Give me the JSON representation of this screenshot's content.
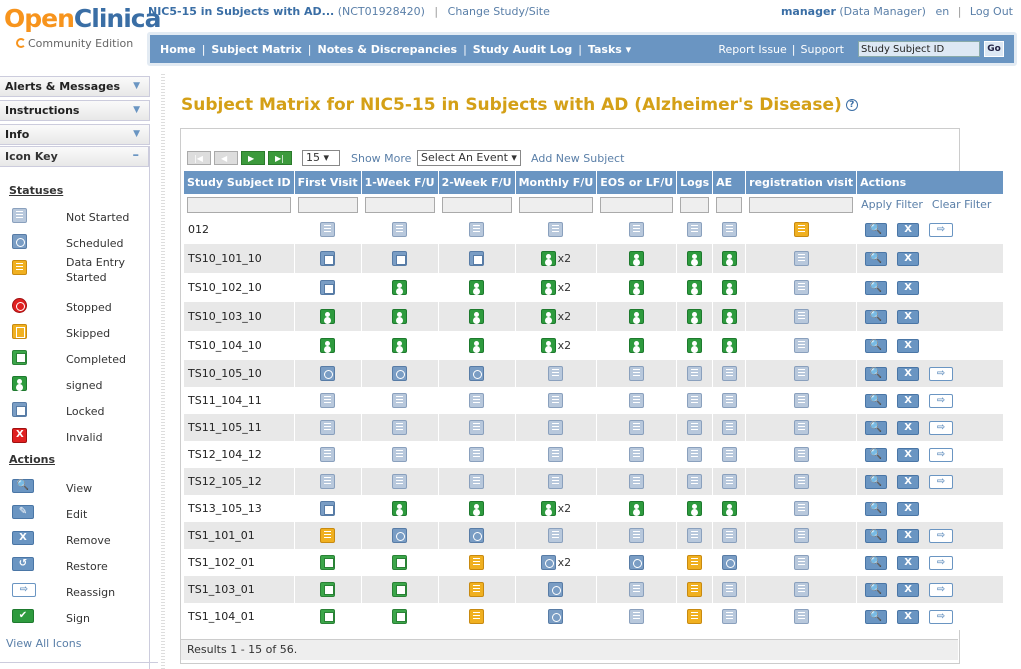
{
  "app": {
    "logo_open": "Open",
    "logo_clinica": "Clinica",
    "logo_edition": "Community Edition"
  },
  "header": {
    "study_name": "NIC5-15 in Subjects with AD...",
    "protocol_id": "(NCT01928420)",
    "separator": "|",
    "change_study": "Change Study/Site",
    "username": "manager",
    "role": "(Data Manager)",
    "language": "en",
    "logout": "Log Out"
  },
  "nav": {
    "items": [
      "Home",
      "Subject Matrix",
      "Notes & Discrepancies",
      "Study Audit Log",
      "Tasks ▾"
    ],
    "report_issue": "Report Issue",
    "support": "Support",
    "search_value": "Study Subject ID",
    "go_label": "Go"
  },
  "sidebar": {
    "panels": [
      "Alerts & Messages",
      "Instructions",
      "Info"
    ],
    "icon_key_title": "Icon Key",
    "statuses_title": "Statuses",
    "statuses": [
      {
        "icon": "not-started-icon",
        "label": "Not Started"
      },
      {
        "icon": "scheduled-icon",
        "label": "Scheduled"
      },
      {
        "icon": "data-entry-started-icon",
        "label": "Data Entry Started"
      },
      {
        "icon": "stopped-icon",
        "label": "Stopped"
      },
      {
        "icon": "skipped-icon",
        "label": "Skipped"
      },
      {
        "icon": "completed-icon",
        "label": "Completed"
      },
      {
        "icon": "signed-icon",
        "label": "signed"
      },
      {
        "icon": "locked-icon",
        "label": "Locked"
      },
      {
        "icon": "invalid-icon",
        "label": "Invalid"
      }
    ],
    "actions_title": "Actions",
    "actions": [
      {
        "icon": "view-icon",
        "label": "View"
      },
      {
        "icon": "edit-icon",
        "label": "Edit"
      },
      {
        "icon": "remove-icon",
        "label": "Remove"
      },
      {
        "icon": "restore-icon",
        "label": "Restore"
      },
      {
        "icon": "reassign-icon",
        "label": "Reassign"
      },
      {
        "icon": "sign-icon",
        "label": "Sign"
      }
    ],
    "view_all_icons": "View All Icons"
  },
  "main": {
    "title": "Subject Matrix for NIC5-15 in Subjects with AD (Alzheimer's Disease)",
    "page_size": "15 ▾",
    "show_more": "Show More",
    "select_event": "Select An Event ▾",
    "add_new_subject": "Add New Subject",
    "apply_filter": "Apply Filter",
    "clear_filter": "Clear Filter",
    "columns": [
      "Study Subject ID",
      "First Visit",
      "1-Week F/U",
      "2-Week F/U",
      "Monthly F/U",
      "EOS or LF/U",
      "Logs",
      "AE",
      "registration visit",
      "Actions"
    ],
    "results": "Results 1 - 15 of 56."
  },
  "colors": {
    "accent": "#6a95c2",
    "title": "#d4a017",
    "completed": "#3ca64a",
    "signed": "#2e9b3e",
    "data_entry_started": "#f0b020",
    "stopped": "#e02020"
  },
  "rows": [
    {
      "id": "012",
      "ev": [
        "ns",
        "ns",
        "ns",
        "ns",
        "ns",
        "ns",
        "ns",
        "des"
      ],
      "mult": [
        "",
        "",
        "",
        "",
        "",
        "",
        "",
        ""
      ],
      "acts": [
        "view",
        "remove",
        "reassign"
      ]
    },
    {
      "id": "TS10_101_10",
      "ev": [
        "lock",
        "lock",
        "lock",
        "sig",
        "sig",
        "sig",
        "sig",
        "ns"
      ],
      "mult": [
        "",
        "",
        "",
        "x2",
        "",
        "",
        "",
        ""
      ],
      "acts": [
        "view",
        "remove"
      ]
    },
    {
      "id": "TS10_102_10",
      "ev": [
        "lock",
        "sig",
        "sig",
        "sig",
        "sig",
        "sig",
        "sig",
        "ns"
      ],
      "mult": [
        "",
        "",
        "",
        "x2",
        "",
        "",
        "",
        ""
      ],
      "acts": [
        "view",
        "remove"
      ]
    },
    {
      "id": "TS10_103_10",
      "ev": [
        "sig",
        "sig",
        "sig",
        "sig",
        "sig",
        "sig",
        "sig",
        "ns"
      ],
      "mult": [
        "",
        "",
        "",
        "x2",
        "",
        "",
        "",
        ""
      ],
      "acts": [
        "view",
        "remove"
      ]
    },
    {
      "id": "TS10_104_10",
      "ev": [
        "sig",
        "sig",
        "sig",
        "sig",
        "sig",
        "sig",
        "sig",
        "ns"
      ],
      "mult": [
        "",
        "",
        "",
        "x2",
        "",
        "",
        "",
        ""
      ],
      "acts": [
        "view",
        "remove"
      ]
    },
    {
      "id": "TS10_105_10",
      "ev": [
        "sch",
        "sch",
        "sch",
        "ns",
        "ns",
        "ns",
        "ns",
        "ns"
      ],
      "mult": [
        "",
        "",
        "",
        "",
        "",
        "",
        "",
        ""
      ],
      "acts": [
        "view",
        "remove",
        "reassign"
      ]
    },
    {
      "id": "TS11_104_11",
      "ev": [
        "ns",
        "ns",
        "ns",
        "ns",
        "ns",
        "ns",
        "ns",
        "ns"
      ],
      "mult": [
        "",
        "",
        "",
        "",
        "",
        "",
        "",
        ""
      ],
      "acts": [
        "view",
        "remove",
        "reassign"
      ]
    },
    {
      "id": "TS11_105_11",
      "ev": [
        "ns",
        "ns",
        "ns",
        "ns",
        "ns",
        "ns",
        "ns",
        "ns"
      ],
      "mult": [
        "",
        "",
        "",
        "",
        "",
        "",
        "",
        ""
      ],
      "acts": [
        "view",
        "remove",
        "reassign"
      ]
    },
    {
      "id": "TS12_104_12",
      "ev": [
        "ns",
        "ns",
        "ns",
        "ns",
        "ns",
        "ns",
        "ns",
        "ns"
      ],
      "mult": [
        "",
        "",
        "",
        "",
        "",
        "",
        "",
        ""
      ],
      "acts": [
        "view",
        "remove",
        "reassign"
      ]
    },
    {
      "id": "TS12_105_12",
      "ev": [
        "ns",
        "ns",
        "ns",
        "ns",
        "ns",
        "ns",
        "ns",
        "ns"
      ],
      "mult": [
        "",
        "",
        "",
        "",
        "",
        "",
        "",
        ""
      ],
      "acts": [
        "view",
        "remove",
        "reassign"
      ]
    },
    {
      "id": "TS13_105_13",
      "ev": [
        "lock",
        "sig",
        "sig",
        "sig",
        "sig",
        "sig",
        "sig",
        "ns"
      ],
      "mult": [
        "",
        "",
        "",
        "x2",
        "",
        "",
        "",
        ""
      ],
      "acts": [
        "view",
        "remove"
      ]
    },
    {
      "id": "TS1_101_01",
      "ev": [
        "des",
        "sch",
        "sch",
        "ns",
        "ns",
        "ns",
        "ns",
        "ns"
      ],
      "mult": [
        "",
        "",
        "",
        "",
        "",
        "",
        "",
        ""
      ],
      "acts": [
        "view",
        "remove",
        "reassign"
      ]
    },
    {
      "id": "TS1_102_01",
      "ev": [
        "cmp",
        "cmp",
        "des",
        "sch",
        "sch",
        "des",
        "sch",
        "ns"
      ],
      "mult": [
        "",
        "",
        "",
        "x2",
        "",
        "",
        "",
        ""
      ],
      "acts": [
        "view",
        "remove",
        "reassign"
      ]
    },
    {
      "id": "TS1_103_01",
      "ev": [
        "cmp",
        "cmp",
        "des",
        "sch",
        "ns",
        "des",
        "ns",
        "ns"
      ],
      "mult": [
        "",
        "",
        "",
        "",
        "",
        "",
        "",
        ""
      ],
      "acts": [
        "view",
        "remove",
        "reassign"
      ]
    },
    {
      "id": "TS1_104_01",
      "ev": [
        "cmp",
        "cmp",
        "des",
        "sch",
        "ns",
        "des",
        "ns",
        "ns"
      ],
      "mult": [
        "",
        "",
        "",
        "",
        "",
        "",
        "",
        ""
      ],
      "acts": [
        "view",
        "remove",
        "reassign"
      ]
    }
  ]
}
